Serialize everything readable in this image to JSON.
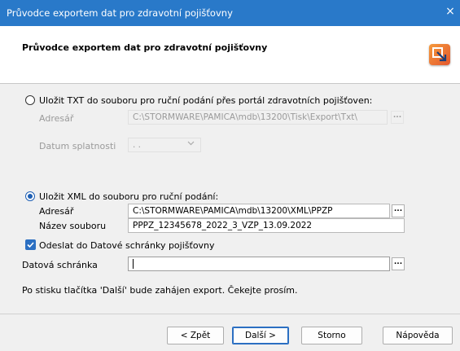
{
  "window": {
    "title": "Průvodce exportem dat pro zdravotní pojišťovny",
    "close_glyph": "×"
  },
  "header": {
    "title": "Průvodce exportem dat pro zdravotní pojišťovny",
    "logo_icon": "export-wizard-icon"
  },
  "txt_section": {
    "option_label": "Uložit TXT do souboru pro ruční podání přes portál zdravotních pojišťoven:",
    "selected": false,
    "directory_label": "Adresář",
    "directory_value": "C:\\STORMWARE\\PAMICA\\mdb\\13200\\Tisk\\Export\\Txt\\",
    "due_date_label": "Datum splatnosti",
    "due_date_value": ". .",
    "browse_glyph": "..."
  },
  "xml_section": {
    "option_label": "Uložit XML do souboru pro ruční podání:",
    "selected": true,
    "directory_label": "Adresář",
    "directory_value": "C:\\STORMWARE\\PAMICA\\mdb\\13200\\XML\\PPZP",
    "filename_label": "Název souboru",
    "filename_value": "PPPZ_12345678_2022_3_VZP_13.09.2022",
    "browse_glyph": "..."
  },
  "databox": {
    "checkbox_label": "Odeslat do Datové schránky pojišťovny",
    "checked": true,
    "field_label": "Datová schránka",
    "field_value": "",
    "browse_glyph": "..."
  },
  "info_text": "Po stisku tlačítka 'Další' bude zahájen export. Čekejte prosím.",
  "buttons": {
    "back": "< Zpět",
    "next": "Další >",
    "cancel": "Storno",
    "help": "Nápověda"
  },
  "colors": {
    "titlebar": "#2979c9",
    "accent": "#2b6fc2"
  }
}
